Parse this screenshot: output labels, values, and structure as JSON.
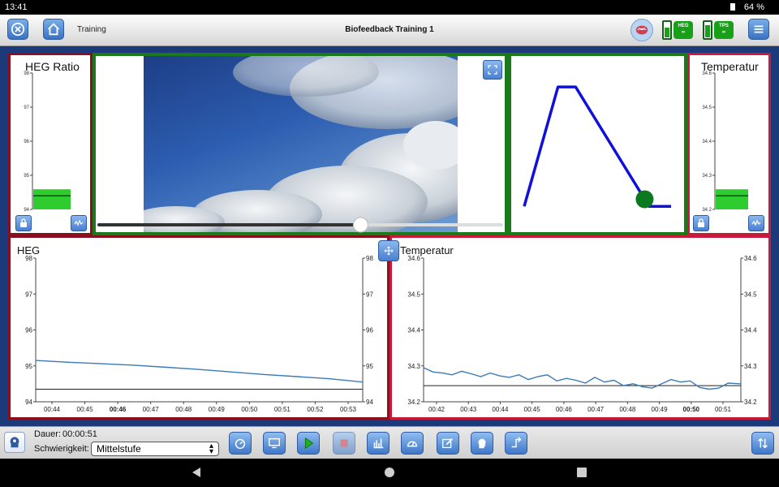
{
  "status_bar": {
    "time": "13:41",
    "battery": "64 %"
  },
  "top_bar": {
    "breadcrumb": "Training",
    "title": "Biofeedback Training 1",
    "devices": [
      {
        "label_top": "HEG",
        "label_bottom": "∞"
      },
      {
        "label_top": "TPS",
        "label_bottom": "∞"
      }
    ]
  },
  "panels": {
    "heg_ratio": {
      "title": "HEG Ratio",
      "ticks": [
        "98",
        "97",
        "96",
        "95",
        "94"
      ],
      "bar_value": 94.4
    },
    "temperature_gauge": {
      "title": "Temperatur",
      "ticks": [
        "34.6",
        "34.5",
        "34.4",
        "34.3",
        "34.2"
      ],
      "bar_value": 34.24
    },
    "video": {
      "progress": 0.65
    },
    "heg_chart": {
      "title": "HEG"
    },
    "temp_chart": {
      "title": "Temperatur"
    }
  },
  "chart_data": [
    {
      "type": "line",
      "title": "HEG",
      "x_ticks": [
        "00:44",
        "00:45",
        "00:46",
        "00:47",
        "00:48",
        "00:49",
        "00:50",
        "00:51",
        "00:52",
        "00:53"
      ],
      "bold_tick": "00:46",
      "y_ticks": [
        "98",
        "97",
        "96",
        "95",
        "94"
      ],
      "ylim": [
        94,
        98
      ],
      "threshold": 94.35,
      "series": [
        {
          "x": [
            0,
            0.1,
            0.2,
            0.3,
            0.4,
            0.5,
            0.6,
            0.7,
            0.8,
            0.9,
            1.0
          ],
          "values": [
            95.15,
            95.1,
            95.06,
            95.02,
            94.96,
            94.9,
            94.83,
            94.76,
            94.7,
            94.64,
            94.55
          ]
        }
      ]
    },
    {
      "type": "line",
      "title": "Temperatur",
      "x_ticks": [
        "00:42",
        "00:43",
        "00:44",
        "00:45",
        "00:46",
        "00:47",
        "00:48",
        "00:49",
        "00:50",
        "00:51"
      ],
      "bold_tick": "00:50",
      "y_ticks": [
        "34.6",
        "34.5",
        "34.4",
        "34.3",
        "34.2"
      ],
      "ylim": [
        34.2,
        34.6
      ],
      "threshold": 34.245,
      "series": [
        {
          "x": [
            0,
            0.03,
            0.06,
            0.09,
            0.12,
            0.15,
            0.18,
            0.21,
            0.24,
            0.27,
            0.3,
            0.33,
            0.36,
            0.39,
            0.42,
            0.45,
            0.48,
            0.51,
            0.54,
            0.57,
            0.6,
            0.63,
            0.66,
            0.69,
            0.72,
            0.75,
            0.78,
            0.81,
            0.84,
            0.87,
            0.9,
            0.93,
            0.96,
            1.0
          ],
          "values": [
            34.295,
            34.283,
            34.28,
            34.275,
            34.285,
            34.278,
            34.27,
            34.28,
            34.272,
            34.268,
            34.275,
            34.262,
            34.27,
            34.275,
            34.258,
            34.265,
            34.26,
            34.252,
            34.268,
            34.255,
            34.26,
            34.245,
            34.25,
            34.242,
            34.238,
            34.25,
            34.262,
            34.255,
            34.258,
            34.24,
            34.235,
            34.238,
            34.252,
            34.25
          ]
        }
      ]
    },
    {
      "type": "line",
      "title": "",
      "x": [
        0,
        0.23,
        0.35,
        0.85,
        1.0
      ],
      "values": [
        0.08,
        0.88,
        0.88,
        0.08,
        0.08
      ],
      "marker_position": 0.82
    }
  ],
  "bottom_bar": {
    "duration_label": "Dauer:",
    "duration_value": "00:00:51",
    "difficulty_label": "Schwierigkeit:",
    "difficulty_value": "Mittelstufe"
  }
}
